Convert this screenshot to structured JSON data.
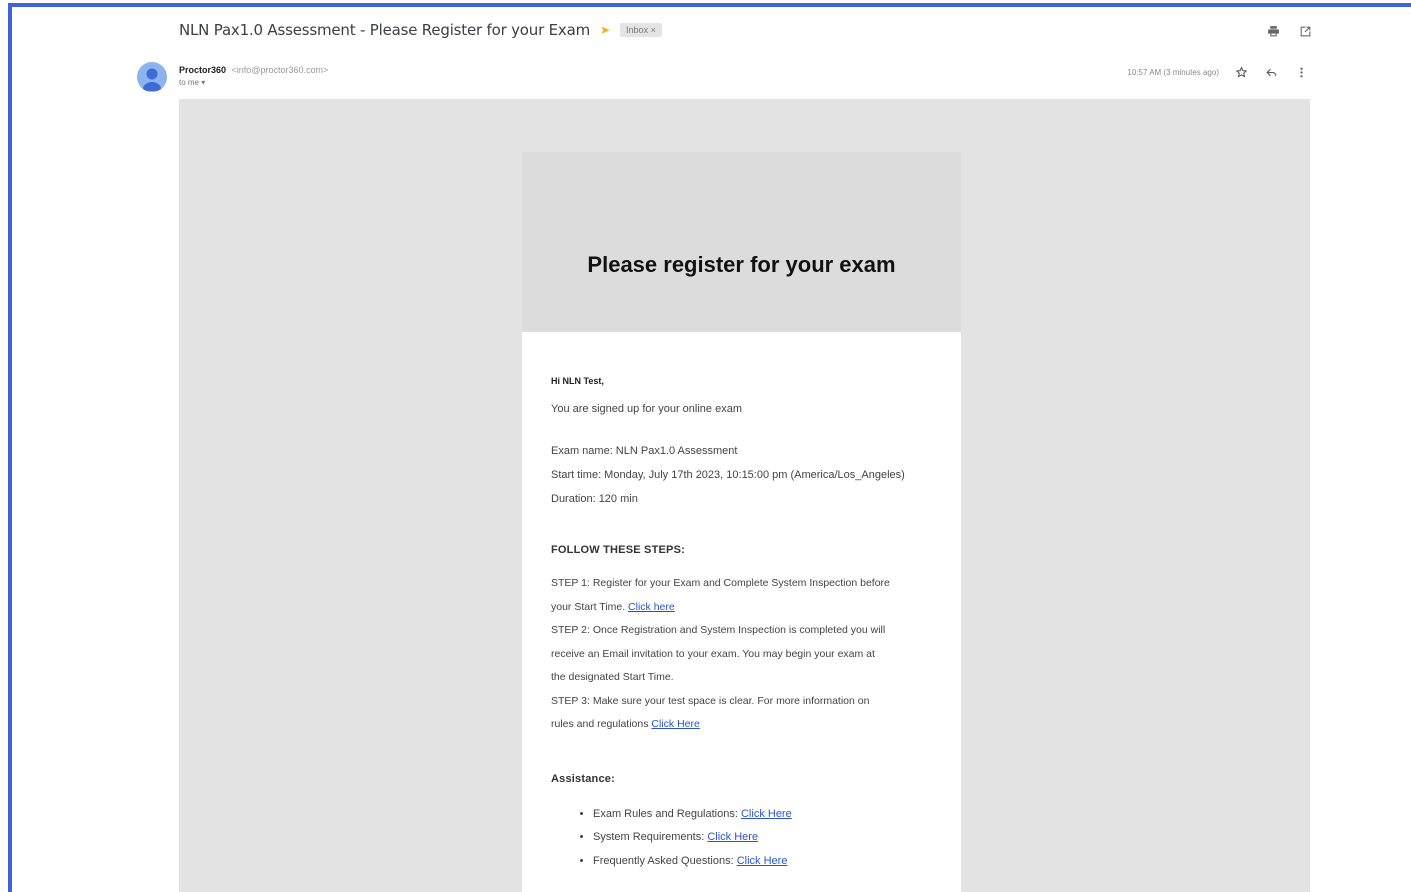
{
  "subject": "NLN Pax1.0 Assessment - Please Register for your Exam",
  "label": "Inbox ×",
  "sender": {
    "name": "Proctor360",
    "email": "<info@proctor360.com>",
    "to": "to me ▾"
  },
  "timestamp": "10:57 AM (3 minutes ago)",
  "colors": {
    "frame_border": "#3f63d8",
    "link": "#2b55c9",
    "body_bg": "#e3e3e3",
    "important": "#f2b01e"
  },
  "icons": {
    "important": "important-marker-icon",
    "print": "print-icon",
    "new_window": "open-in-new-window-icon",
    "star": "star-icon",
    "reply": "reply-icon",
    "more": "more-vert-icon",
    "avatar": "avatar-person-icon"
  },
  "email": {
    "title": "Please register for your exam",
    "greeting": "Hi NLN Test,",
    "intro": "You are signed up for your online exam",
    "exam_name": "Exam name: NLN Pax1.0 Assessment",
    "start_time": "Start time: Monday, July 17th 2023, 10:15:00 pm (America/Los_Angeles)",
    "duration": "Duration: 120 min",
    "steps_heading": "FOLLOW THESE STEPS:",
    "step1_line1": "STEP 1: Register for your Exam and Complete System Inspection before",
    "step1_line2": "your Start Time.",
    "step1_link": "Click here",
    "step2_line1": "STEP 2: Once Registration and System Inspection is completed you will",
    "step2_line2": "receive an Email invitation to your exam. You may begin your exam at",
    "step2_line3": "the designated Start Time.",
    "step3_line1": "STEP 3: Make sure your test space is clear. For more information on",
    "step3_line2": "rules and regulations",
    "step3_link": "Click Here",
    "assistance_heading": "Assistance:",
    "assistance": [
      {
        "label": "Exam Rules and Regulations:",
        "link": "Click Here"
      },
      {
        "label": "System Requirements:",
        "link": "Click Here"
      },
      {
        "label": "Frequently Asked Questions:",
        "link": "Click Here"
      }
    ]
  }
}
